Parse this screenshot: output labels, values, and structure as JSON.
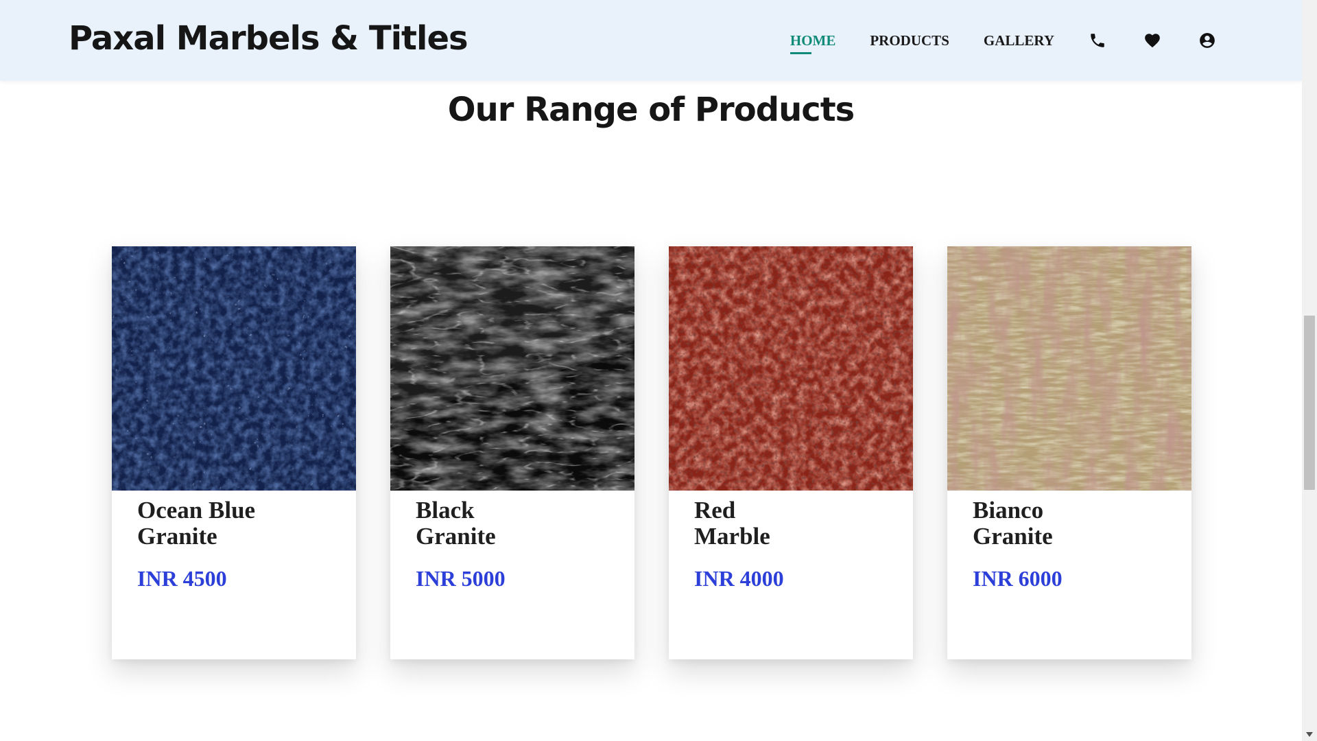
{
  "header": {
    "logo": "Paxal Marbels & Titles",
    "nav": [
      {
        "label": "HOME",
        "active": true
      },
      {
        "label": "PRODUCTS",
        "active": false
      },
      {
        "label": "GALLERY",
        "active": false
      }
    ],
    "icons": [
      "phone-icon",
      "heart-icon",
      "account-icon"
    ]
  },
  "section": {
    "title": "Our Range of Products"
  },
  "products": [
    {
      "name": "Ocean Blue\nGranite",
      "price": "INR 4500",
      "texture": "ocean-blue-granite",
      "colors": [
        "#1f3770",
        "#4b6bb3",
        "#0e1a35"
      ]
    },
    {
      "name": "Black\nGranite",
      "price": "INR 5000",
      "texture": "black-granite",
      "colors": [
        "#0d0d0d",
        "#3a3a3a",
        "#cfcfcf"
      ]
    },
    {
      "name": "Red\nMarble",
      "price": "INR 4000",
      "texture": "red-marble",
      "colors": [
        "#8e2418",
        "#c65a45",
        "#3a0e0a"
      ]
    },
    {
      "name": "Bianco\nGranite",
      "price": "INR 6000",
      "texture": "bianco-granite",
      "colors": [
        "#b8a27a",
        "#8a5a4a",
        "#d7c9a0"
      ]
    }
  ],
  "colors": {
    "header_bg": "#e9f1fb",
    "active_nav": "#0f8b78",
    "price": "#2d3fd9"
  }
}
